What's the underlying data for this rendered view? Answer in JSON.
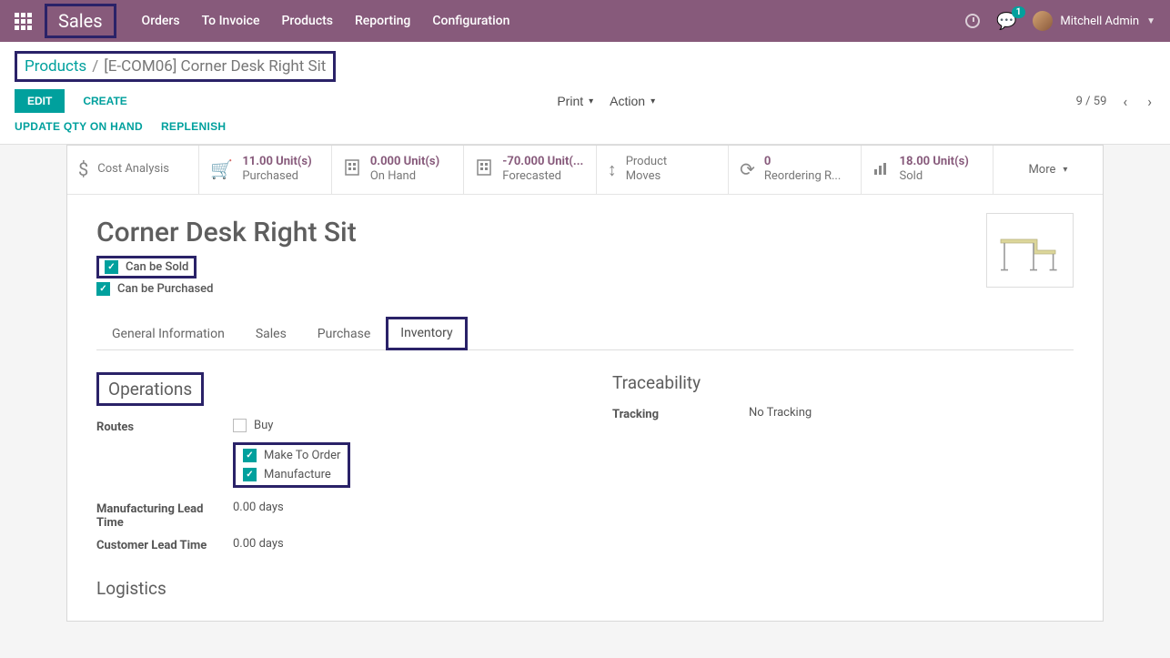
{
  "navbar": {
    "brand": "Sales",
    "links": [
      "Orders",
      "To Invoice",
      "Products",
      "Reporting",
      "Configuration"
    ],
    "chat_count": "1",
    "user_name": "Mitchell Admin"
  },
  "breadcrumb": {
    "parent": "Products",
    "current": "[E-COM06] Corner Desk Right Sit"
  },
  "buttons": {
    "edit": "EDIT",
    "create": "CREATE",
    "print": "Print",
    "action": "Action",
    "update_qty": "UPDATE QTY ON HAND",
    "replenish": "REPLENISH"
  },
  "pager": {
    "text": "9 / 59"
  },
  "stats": {
    "cost_analysis": "Cost Analysis",
    "purchased_value": "11.00 Unit(s)",
    "purchased_label": "Purchased",
    "onhand_value": "0.000 Unit(s)",
    "onhand_label": "On Hand",
    "forecast_value": "-70.000 Unit(...",
    "forecast_label": "Forecasted",
    "moves_label_top": "Product",
    "moves_label_bottom": "Moves",
    "reorder_value": "0",
    "reorder_label": "Reordering R...",
    "sold_value": "18.00 Unit(s)",
    "sold_label": "Sold",
    "more": "More"
  },
  "product": {
    "name": "Corner Desk Right Sit",
    "can_be_sold": "Can be Sold",
    "can_be_purchased": "Can be Purchased"
  },
  "tabs": [
    "General Information",
    "Sales",
    "Purchase",
    "Inventory"
  ],
  "inventory": {
    "operations_title": "Operations",
    "routes_label": "Routes",
    "route_buy": "Buy",
    "route_mto": "Make To Order",
    "route_manufacture": "Manufacture",
    "manuf_lead_label": "Manufacturing Lead Time",
    "manuf_lead_value": "0.00 days",
    "cust_lead_label": "Customer Lead Time",
    "cust_lead_value": "0.00 days",
    "trace_title": "Traceability",
    "tracking_label": "Tracking",
    "tracking_value": "No Tracking",
    "logistics_title": "Logistics"
  }
}
